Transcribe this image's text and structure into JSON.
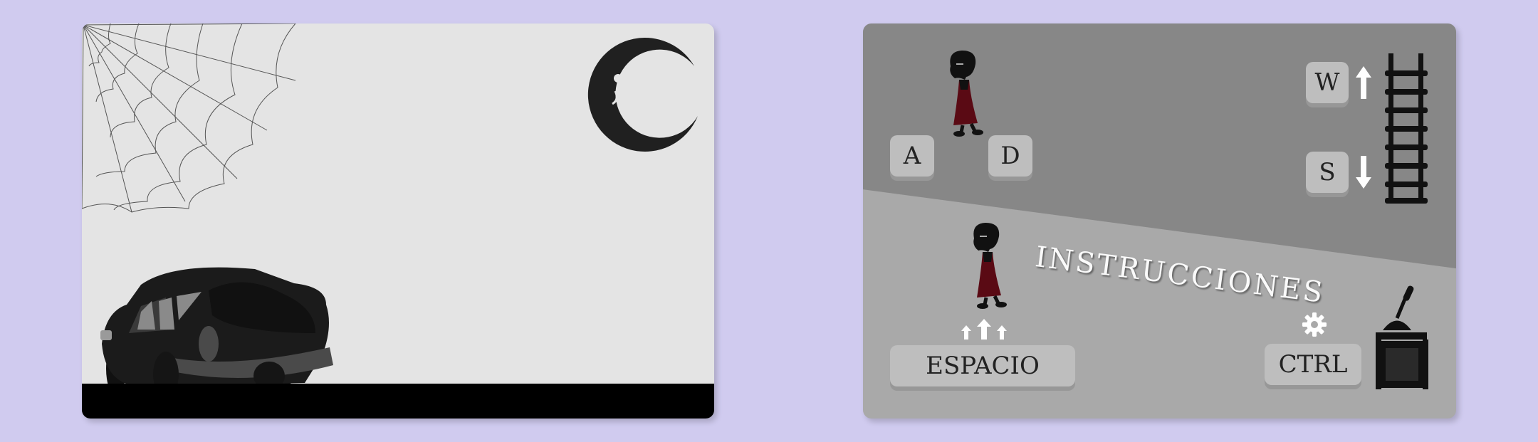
{
  "scene": {
    "elements": [
      "spider-web",
      "crescent-moon",
      "old-car",
      "ground"
    ]
  },
  "instructions": {
    "title": "INSTRUCCIONES",
    "keys": {
      "left": "A",
      "right": "D",
      "up": "W",
      "down": "S",
      "jump": "ESPACIO",
      "action": "CTRL"
    }
  },
  "colors": {
    "background": "#d0cbef",
    "scene_sky": "#e4e4e4",
    "ground": "#000000",
    "instructions_dark": "#878787",
    "instructions_light": "#a9a9a9",
    "key_face": "#bebebe",
    "dress": "#5a0a14"
  }
}
